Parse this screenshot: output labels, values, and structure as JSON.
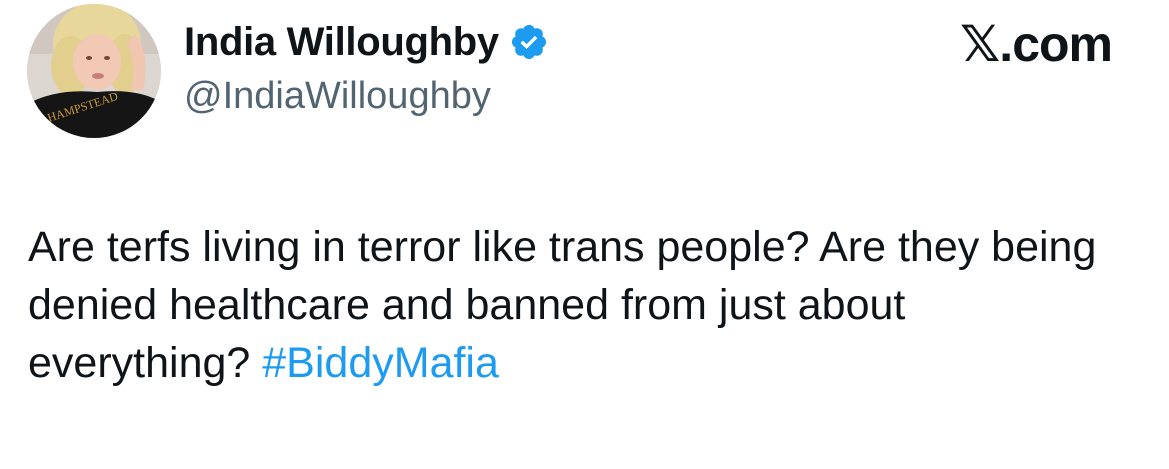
{
  "author": {
    "display_name": "India Willoughby",
    "handle": "@IndiaWilloughby",
    "verified": true,
    "avatar_shirt_text": "HAMPSTEAD"
  },
  "brand": {
    "label": "𝕏.com"
  },
  "tweet": {
    "text": "Are terfs living in terror like trans people? Are they being denied healthcare and banned from just about everything?",
    "hashtag": "#BiddyMafia"
  },
  "colors": {
    "text": "#0f1419",
    "secondary": "#536471",
    "accent": "#1d9bf0",
    "verified": "#1d9bf0"
  },
  "icons": {
    "verified": "verified-badge-icon",
    "brand": "x-logo"
  }
}
